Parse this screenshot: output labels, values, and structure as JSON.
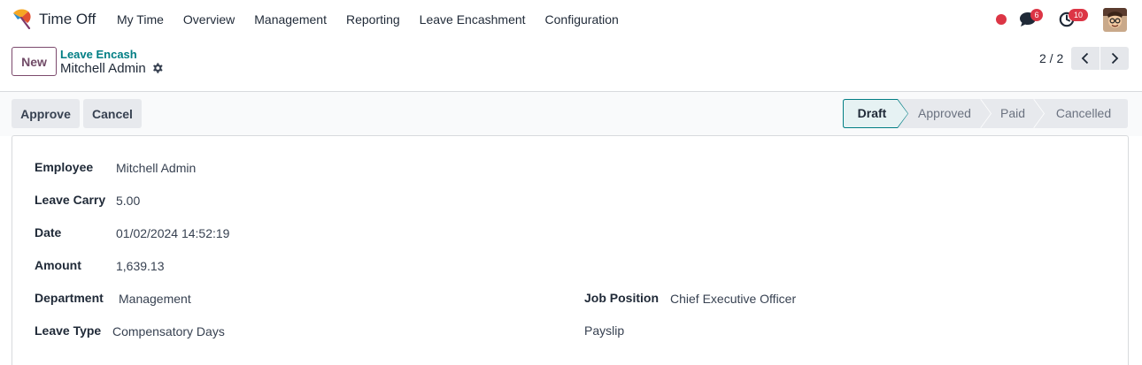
{
  "app": {
    "title": "Time Off",
    "logo": "time-off-app-logo"
  },
  "menu": [
    "My Time",
    "Overview",
    "Management",
    "Reporting",
    "Leave Encashment",
    "Configuration"
  ],
  "systray": {
    "messages_count": "6",
    "activities_count": "10",
    "status_color": "#dc3545"
  },
  "control_panel": {
    "new_label": "New",
    "breadcrumb_parent": "Leave Encash",
    "breadcrumb_current": "Mitchell Admin",
    "pager": "2 / 2"
  },
  "statusbar": {
    "approve_label": "Approve",
    "cancel_label": "Cancel",
    "stages": [
      "Draft",
      "Approved",
      "Paid",
      "Cancelled"
    ],
    "active_stage": "Draft"
  },
  "form": {
    "employee_label": "Employee",
    "employee_value": "Mitchell Admin",
    "leave_carry_label": "Leave Carry",
    "leave_carry_value": "5.00",
    "date_label": "Date",
    "date_value": "01/02/2024 14:52:19",
    "amount_label": "Amount",
    "amount_value": "1,639.13",
    "department_label": "Department",
    "department_value": "Management",
    "job_position_label": "Job Position",
    "job_position_value": "Chief Executive Officer",
    "leave_type_label": "Leave Type",
    "leave_type_value": "Compensatory Days",
    "payslip_label": "Payslip"
  },
  "colors": {
    "brand": "#714b67",
    "accent": "#017e84",
    "active_stage_bg": "#e6f2f3"
  }
}
